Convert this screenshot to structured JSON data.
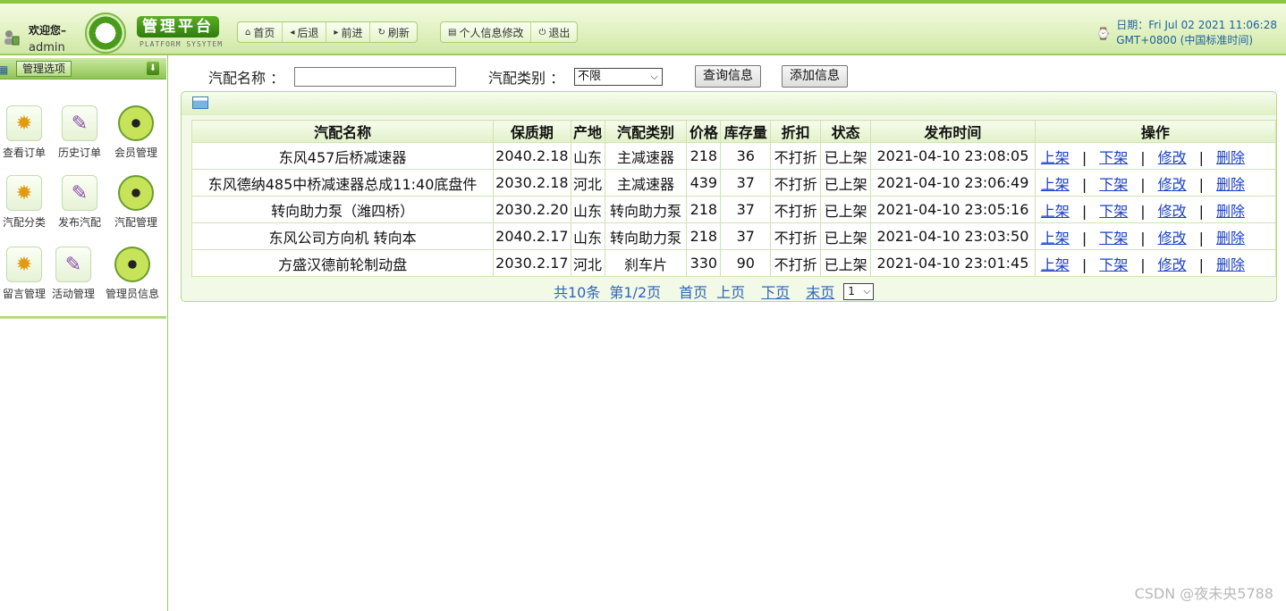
{
  "header": {
    "welcome": "欢迎您–",
    "username": "admin",
    "logo_title": "管理平台",
    "logo_subtitle": "PLATFORM SYSYTEM",
    "nav1": [
      {
        "icon": "⌂",
        "label": "首页"
      },
      {
        "icon": "◂",
        "label": "后退"
      },
      {
        "icon": "▸",
        "label": "前进"
      },
      {
        "icon": "↻",
        "label": "刷新"
      }
    ],
    "nav2": [
      {
        "icon": "▤",
        "label": "个人信息修改"
      },
      {
        "icon": "⏻",
        "label": "退出"
      }
    ],
    "date_line1": "日期：Fri Jul 02 2021 11:06:28",
    "date_line2": "GMT+0800 (中国标准时间)"
  },
  "sidebar": {
    "title": "管理选项",
    "collapse_icon": "⬇",
    "items": [
      {
        "label": "查看订单",
        "icon": "gear-icon"
      },
      {
        "label": "历史订单",
        "icon": "book-icon"
      },
      {
        "label": "会员管理",
        "icon": "radiation-icon"
      },
      {
        "label": "汽配分类",
        "icon": "gear-icon"
      },
      {
        "label": "发布汽配",
        "icon": "book-icon"
      },
      {
        "label": "汽配管理",
        "icon": "radiation-icon"
      },
      {
        "label": "留言管理",
        "icon": "gear-icon"
      },
      {
        "label": "活动管理",
        "icon": "book-icon"
      },
      {
        "label": "管理员信息",
        "icon": "radiation-icon"
      }
    ]
  },
  "search": {
    "name_label": "汽配名称 ：",
    "name_value": "",
    "type_label": "汽配类别 ：",
    "type_selected": "不限",
    "query_button": "查询信息",
    "add_button": "添加信息"
  },
  "table": {
    "headers": [
      "汽配名称",
      "保质期",
      "产地",
      "汽配类别",
      "价格",
      "库存量",
      "折扣",
      "状态",
      "发布时间",
      "操作"
    ],
    "rows": [
      [
        "东风457后桥减速器",
        "2040.2.18",
        "山东",
        "主减速器",
        "218",
        "36",
        "不打折",
        "已上架",
        "2021-04-10 23:08:05"
      ],
      [
        "东风德纳485中桥减速器总成11:40底盘件",
        "2030.2.18",
        "河北",
        "主减速器",
        "439",
        "37",
        "不打折",
        "已上架",
        "2021-04-10 23:06:49"
      ],
      [
        "转向助力泵（潍四桥）",
        "2030.2.20",
        "山东",
        "转向助力泵",
        "218",
        "37",
        "不打折",
        "已上架",
        "2021-04-10 23:05:16"
      ],
      [
        "东风公司方向机 转向本",
        "2040.2.17",
        "山东",
        "转向助力泵",
        "218",
        "37",
        "不打折",
        "已上架",
        "2021-04-10 23:03:50"
      ],
      [
        "方盛汉德前轮制动盘",
        "2030.2.17",
        "河北",
        "刹车片",
        "330",
        "90",
        "不打折",
        "已上架",
        "2021-04-10 23:01:45"
      ]
    ],
    "ops": [
      "上架",
      "下架",
      "修改",
      "删除"
    ],
    "op_separator": "|"
  },
  "pager": {
    "total": "共10条",
    "page": "第1/2页",
    "first": "首页",
    "prev": "上页",
    "next": "下页",
    "last": "末页",
    "selected": "1"
  },
  "watermark": "CSDN @夜未央5788",
  "colors": {
    "accent_green": "#8cc63f",
    "link_blue": "#1a3fc8",
    "pager_blue": "#2f64b8"
  }
}
